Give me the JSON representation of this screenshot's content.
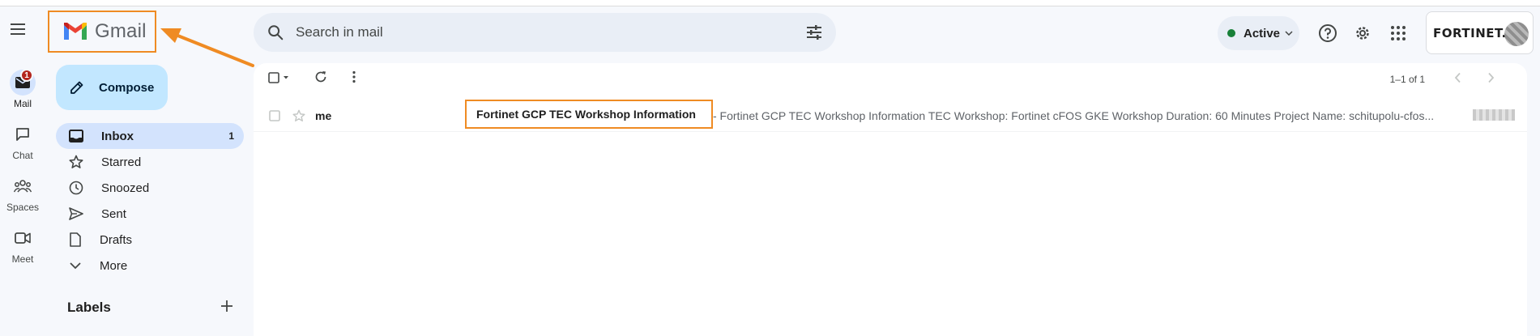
{
  "app": {
    "logo_text": "Gmail"
  },
  "search": {
    "placeholder": "Search in mail"
  },
  "header": {
    "status_label": "Active",
    "account_brand": "FORTINET."
  },
  "rail": [
    {
      "label": "Mail",
      "badge": "1"
    },
    {
      "label": "Chat"
    },
    {
      "label": "Spaces"
    },
    {
      "label": "Meet"
    }
  ],
  "compose_label": "Compose",
  "nav": [
    {
      "label": "Inbox",
      "count": "1",
      "icon": "inbox-icon"
    },
    {
      "label": "Starred",
      "icon": "star-icon"
    },
    {
      "label": "Snoozed",
      "icon": "clock-icon"
    },
    {
      "label": "Sent",
      "icon": "send-icon"
    },
    {
      "label": "Drafts",
      "icon": "draft-icon"
    },
    {
      "label": "More",
      "icon": "chevron-down-icon"
    }
  ],
  "labels_header": "Labels",
  "pager": "1–1 of 1",
  "emails": [
    {
      "sender": "me",
      "subject": "Fortinet GCP TEC Workshop Information",
      "snippet": "- Fortinet GCP TEC Workshop Information TEC Workshop: Fortinet cFOS GKE Workshop Duration: 60 Minutes Project Name: schitupolu-cfos..."
    }
  ],
  "colors": {
    "annotation": "#ef8b23",
    "compose_bg": "#c2e7ff",
    "active_nav": "#d3e3fd",
    "status_green": "#188038"
  }
}
